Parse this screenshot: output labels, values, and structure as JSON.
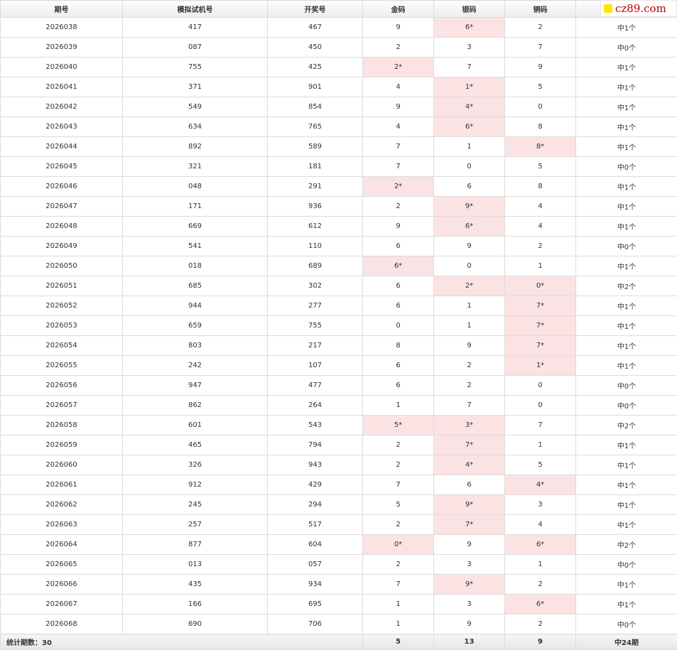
{
  "brand": {
    "logo_text": "cz89.com",
    "logo_color": "#c00000",
    "logo_square_color": "#ffe600"
  },
  "colors": {
    "hit_bg": "#fbe3e4",
    "hit_text": "#cc2222"
  },
  "headers": [
    "期号",
    "模拟试机号",
    "开奖号",
    "金码",
    "银码",
    "铜码",
    ""
  ],
  "rows": [
    {
      "issue": "2026038",
      "trial": "417",
      "draw": "467",
      "gold": "9",
      "silver": "6*",
      "bronze": "2",
      "result": "中1个"
    },
    {
      "issue": "2026039",
      "trial": "087",
      "draw": "450",
      "gold": "2",
      "silver": "3",
      "bronze": "7",
      "result": "中0个"
    },
    {
      "issue": "2026040",
      "trial": "755",
      "draw": "425",
      "gold": "2*",
      "silver": "7",
      "bronze": "9",
      "result": "中1个"
    },
    {
      "issue": "2026041",
      "trial": "371",
      "draw": "901",
      "gold": "4",
      "silver": "1*",
      "bronze": "5",
      "result": "中1个"
    },
    {
      "issue": "2026042",
      "trial": "549",
      "draw": "854",
      "gold": "9",
      "silver": "4*",
      "bronze": "0",
      "result": "中1个"
    },
    {
      "issue": "2026043",
      "trial": "634",
      "draw": "765",
      "gold": "4",
      "silver": "6*",
      "bronze": "8",
      "result": "中1个"
    },
    {
      "issue": "2026044",
      "trial": "892",
      "draw": "589",
      "gold": "7",
      "silver": "1",
      "bronze": "8*",
      "result": "中1个"
    },
    {
      "issue": "2026045",
      "trial": "321",
      "draw": "181",
      "gold": "7",
      "silver": "0",
      "bronze": "5",
      "result": "中0个"
    },
    {
      "issue": "2026046",
      "trial": "048",
      "draw": "291",
      "gold": "2*",
      "silver": "6",
      "bronze": "8",
      "result": "中1个"
    },
    {
      "issue": "2026047",
      "trial": "171",
      "draw": "936",
      "gold": "2",
      "silver": "9*",
      "bronze": "4",
      "result": "中1个"
    },
    {
      "issue": "2026048",
      "trial": "669",
      "draw": "612",
      "gold": "9",
      "silver": "6*",
      "bronze": "4",
      "result": "中1个"
    },
    {
      "issue": "2026049",
      "trial": "541",
      "draw": "110",
      "gold": "6",
      "silver": "9",
      "bronze": "2",
      "result": "中0个"
    },
    {
      "issue": "2026050",
      "trial": "018",
      "draw": "689",
      "gold": "6*",
      "silver": "0",
      "bronze": "1",
      "result": "中1个"
    },
    {
      "issue": "2026051",
      "trial": "685",
      "draw": "302",
      "gold": "6",
      "silver": "2*",
      "bronze": "0*",
      "result": "中2个"
    },
    {
      "issue": "2026052",
      "trial": "944",
      "draw": "277",
      "gold": "6",
      "silver": "1",
      "bronze": "7*",
      "result": "中1个"
    },
    {
      "issue": "2026053",
      "trial": "659",
      "draw": "755",
      "gold": "0",
      "silver": "1",
      "bronze": "7*",
      "result": "中1个"
    },
    {
      "issue": "2026054",
      "trial": "803",
      "draw": "217",
      "gold": "8",
      "silver": "9",
      "bronze": "7*",
      "result": "中1个"
    },
    {
      "issue": "2026055",
      "trial": "242",
      "draw": "107",
      "gold": "6",
      "silver": "2",
      "bronze": "1*",
      "result": "中1个"
    },
    {
      "issue": "2026056",
      "trial": "947",
      "draw": "477",
      "gold": "6",
      "silver": "2",
      "bronze": "0",
      "result": "中0个"
    },
    {
      "issue": "2026057",
      "trial": "862",
      "draw": "264",
      "gold": "1",
      "silver": "7",
      "bronze": "0",
      "result": "中0个"
    },
    {
      "issue": "2026058",
      "trial": "601",
      "draw": "543",
      "gold": "5*",
      "silver": "3*",
      "bronze": "7",
      "result": "中2个"
    },
    {
      "issue": "2026059",
      "trial": "465",
      "draw": "794",
      "gold": "2",
      "silver": "7*",
      "bronze": "1",
      "result": "中1个"
    },
    {
      "issue": "2026060",
      "trial": "326",
      "draw": "943",
      "gold": "2",
      "silver": "4*",
      "bronze": "5",
      "result": "中1个"
    },
    {
      "issue": "2026061",
      "trial": "912",
      "draw": "429",
      "gold": "7",
      "silver": "6",
      "bronze": "4*",
      "result": "中1个"
    },
    {
      "issue": "2026062",
      "trial": "245",
      "draw": "294",
      "gold": "5",
      "silver": "9*",
      "bronze": "3",
      "result": "中1个"
    },
    {
      "issue": "2026063",
      "trial": "257",
      "draw": "517",
      "gold": "2",
      "silver": "7*",
      "bronze": "4",
      "result": "中1个"
    },
    {
      "issue": "2026064",
      "trial": "877",
      "draw": "604",
      "gold": "0*",
      "silver": "9",
      "bronze": "6*",
      "result": "中2个"
    },
    {
      "issue": "2026065",
      "trial": "013",
      "draw": "057",
      "gold": "2",
      "silver": "3",
      "bronze": "1",
      "result": "中0个"
    },
    {
      "issue": "2026066",
      "trial": "435",
      "draw": "934",
      "gold": "7",
      "silver": "9*",
      "bronze": "2",
      "result": "中1个"
    },
    {
      "issue": "2026067",
      "trial": "166",
      "draw": "695",
      "gold": "1",
      "silver": "3",
      "bronze": "6*",
      "result": "中1个"
    },
    {
      "issue": "2026068",
      "trial": "690",
      "draw": "706",
      "gold": "1",
      "silver": "9",
      "bronze": "2",
      "result": "中0个"
    }
  ],
  "footer": {
    "label": "统计期数：30",
    "gold_total": "5",
    "silver_total": "13",
    "bronze_total": "9",
    "result_total": "中24期"
  }
}
